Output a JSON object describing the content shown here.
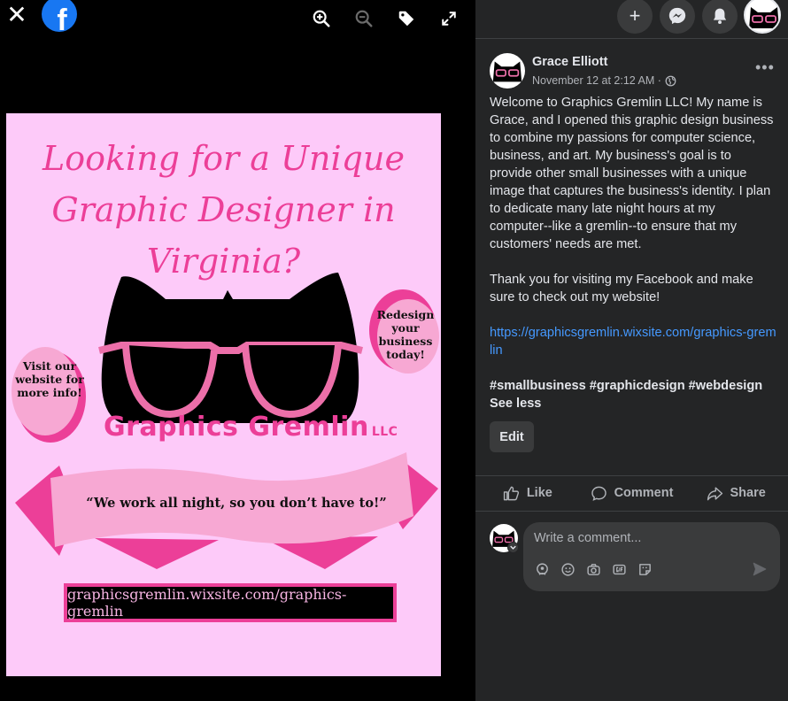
{
  "viewer": {
    "icons": [
      "close-icon",
      "facebook-logo",
      "zoom-in-icon",
      "zoom-out-icon",
      "tag-icon",
      "fullscreen-icon"
    ],
    "close_glyph": "✕",
    "logo_glyph": "f"
  },
  "flyer": {
    "headline": "Looking for a Unique Graphic Designer in Virginia?",
    "brand": "Graphics Gremlin",
    "brand_suffix": "LLC",
    "left_bubble": "Visit our website for more info!",
    "right_bubble": "Redesign your business today!",
    "tagline": "“We work all night, so you don’t have to!”",
    "url": "graphicsgremlin.wixsite.com/graphics-gremlin",
    "colors": {
      "background": "#fdcaf9",
      "accent": "#ec3f98",
      "light_pink": "#f7a8d3"
    }
  },
  "header": {
    "buttons": [
      "plus-icon",
      "messenger-icon",
      "bell-icon"
    ],
    "plus_glyph": "+"
  },
  "post": {
    "author": "Grace Elliott",
    "timestamp": "November 12 at 2:12 AM ·",
    "more_glyph": "•••",
    "paragraph_1": "Welcome to Graphics Gremlin LLC! My name is Grace, and I opened this graphic design business to combine my passions for computer science, business, and art. My business's goal is to provide other small businesses with a unique image that captures the business's identity. I plan to dedicate many late night hours at my computer--like a gremlin--to ensure that my customers' needs are met.",
    "paragraph_2": "Thank you for visiting my Facebook and make sure to check out my website!",
    "link": "https://graphicsgremlin.wixsite.com/graphics-gremlin",
    "hashtags": "#smallbusiness #graphicdesign #webdesign See less",
    "edit_label": "Edit"
  },
  "actions": {
    "like": "Like",
    "comment": "Comment",
    "share": "Share"
  },
  "comment_box": {
    "placeholder": "Write a comment..."
  },
  "theme": {
    "panel_bg": "#242526",
    "surface": "#3a3b3c",
    "text": "#e4e6eb",
    "muted": "#b0b3b8",
    "link": "#4599ff",
    "fb_blue": "#1877f2"
  }
}
